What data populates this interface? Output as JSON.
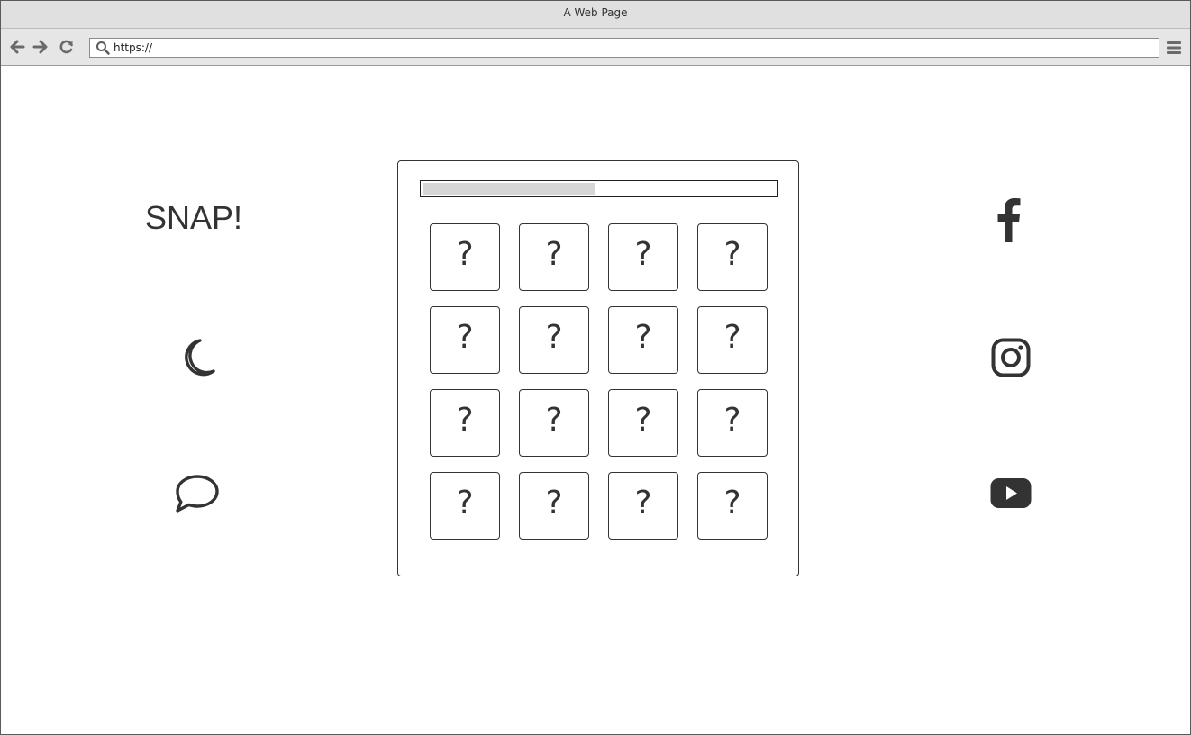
{
  "window": {
    "title": "A Web Page"
  },
  "toolbar": {
    "url": "https://",
    "icons": [
      "back-arrow-icon",
      "forward-arrow-icon",
      "reload-icon",
      "search-icon",
      "hamburger-menu-icon"
    ]
  },
  "left_column": {
    "brand": "SNAP!",
    "icons": [
      "moon-icon",
      "speech-bubble-icon"
    ]
  },
  "right_column": {
    "icons": [
      "facebook-icon",
      "instagram-icon",
      "youtube-icon"
    ]
  },
  "game": {
    "progress": 0.49,
    "cards": [
      {
        "label": "?"
      },
      {
        "label": "?"
      },
      {
        "label": "?"
      },
      {
        "label": "?"
      },
      {
        "label": "?"
      },
      {
        "label": "?"
      },
      {
        "label": "?"
      },
      {
        "label": "?"
      },
      {
        "label": "?"
      },
      {
        "label": "?"
      },
      {
        "label": "?"
      },
      {
        "label": "?"
      },
      {
        "label": "?"
      },
      {
        "label": "?"
      },
      {
        "label": "?"
      },
      {
        "label": "?"
      }
    ]
  },
  "colors": {
    "chrome": "#e6e6e6",
    "ink": "#333333",
    "progress_fill": "#d6d6d6"
  }
}
